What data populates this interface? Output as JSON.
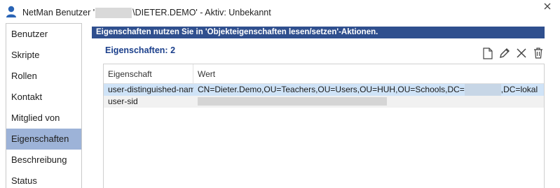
{
  "window": {
    "title_prefix": "NetMan Benutzer '",
    "title_suffix": "\\DIETER.DEMO' - Aktiv: Unbekannt",
    "close_icon": "close-icon"
  },
  "sidebar": {
    "items": [
      {
        "label": "Benutzer"
      },
      {
        "label": "Skripte"
      },
      {
        "label": "Rollen"
      },
      {
        "label": "Kontakt"
      },
      {
        "label": "Mitglied von"
      },
      {
        "label": "Eigenschaften",
        "active": true
      },
      {
        "label": "Beschreibung"
      },
      {
        "label": "Status"
      }
    ]
  },
  "main": {
    "banner": "Eigenschaften nutzen Sie in 'Objekteigenschaften lesen/setzen'-Aktionen.",
    "count_label": "Eigenschaften: 2",
    "toolbar": [
      "new-icon",
      "edit-icon",
      "delete-icon",
      "trash-icon"
    ],
    "table": {
      "headers": [
        "Eigenschaft",
        "Wert"
      ],
      "rows": [
        {
          "name": "user-distinguished-name",
          "value_prefix": "CN=Dieter.Demo,OU=Teachers,OU=Users,OU=HUH,OU=Schools,DC=",
          "value_suffix": ",DC=lokal"
        },
        {
          "name": "user-sid",
          "value_prefix": "",
          "value_suffix": ""
        }
      ]
    }
  },
  "colors": {
    "banner_bg": "#2f4f8e",
    "selected_nav": "#9db3d8",
    "selected_row": "#cfe3f7",
    "count_label": "#1b3f8b"
  }
}
